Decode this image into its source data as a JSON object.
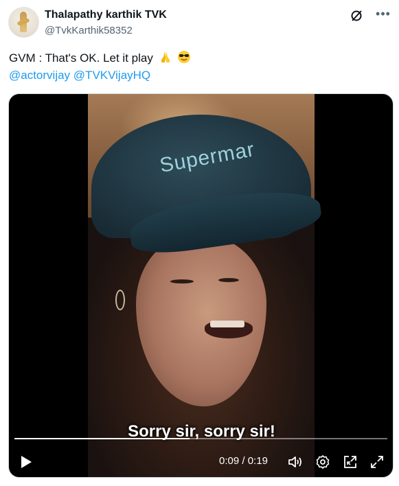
{
  "author": {
    "name": "Thalapathy karthik TVK",
    "handle": "@TvkKarthik58352"
  },
  "header_icons": [
    "grok-icon",
    "more-icon"
  ],
  "tweet": {
    "text": "GVM : That's OK. Let it play",
    "emojis": [
      "folded-hands-emoji",
      "sunglasses-emoji"
    ],
    "mentions": [
      "@actorvijay",
      "@TVKVijayHQ"
    ]
  },
  "video": {
    "subtitle": "Sorry sir, sorry sir!",
    "current_time": "0:09",
    "separator": "/",
    "duration": "0:19",
    "progress_fraction": 0.47,
    "cap_text": "Supermar",
    "controls": [
      "play-icon",
      "volume-icon",
      "settings-icon",
      "pop-out-icon",
      "fullscreen-icon"
    ]
  },
  "colors": {
    "link": "#1d9bf0",
    "text": "#0f1419",
    "secondary": "#536471"
  }
}
